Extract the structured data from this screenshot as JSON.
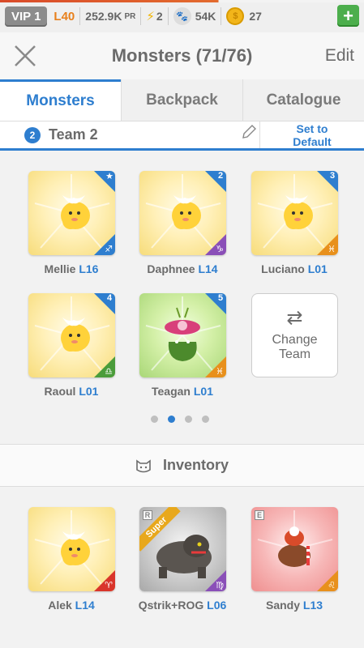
{
  "status": {
    "vip": "VIP 1",
    "level": "L40",
    "power": "252.9K",
    "power_unit": "PR",
    "energy": "2",
    "paw": "54K",
    "coins": "27"
  },
  "header": {
    "title": "Monsters (71/76)",
    "edit": "Edit"
  },
  "tabs": [
    "Monsters",
    "Backpack",
    "Catalogue"
  ],
  "team": {
    "number": "2",
    "name": "Team 2",
    "set_default": [
      "Set to",
      "Default"
    ]
  },
  "team_monsters": [
    {
      "name": "Mellie",
      "level": "L16",
      "slot": "★",
      "sign": "♐"
    },
    {
      "name": "Daphnee",
      "level": "L14",
      "slot": "2",
      "sign": "♑"
    },
    {
      "name": "Luciano",
      "level": "L01",
      "slot": "3",
      "sign": "♓"
    },
    {
      "name": "Raoul",
      "level": "L01",
      "slot": "4",
      "sign": "♎"
    },
    {
      "name": "Teagan",
      "level": "L01",
      "slot": "5",
      "sign": "♓"
    }
  ],
  "change_team": [
    "Change",
    "Team"
  ],
  "pager": {
    "pages": 4,
    "active": 2
  },
  "inventory": {
    "label": "Inventory",
    "items": [
      {
        "name": "Alek",
        "level": "L14",
        "sign": "♈"
      },
      {
        "name": "Qstrik+ROG",
        "level": "L06",
        "sign": "♍",
        "rank": "R",
        "badge": "Super"
      },
      {
        "name": "Sandy",
        "level": "L13",
        "sign": "♌",
        "rank": "E"
      }
    ]
  },
  "colors": {
    "accent": "#2e7ecf",
    "level_orange": "#e8801c",
    "add_green": "#4cae4c"
  }
}
